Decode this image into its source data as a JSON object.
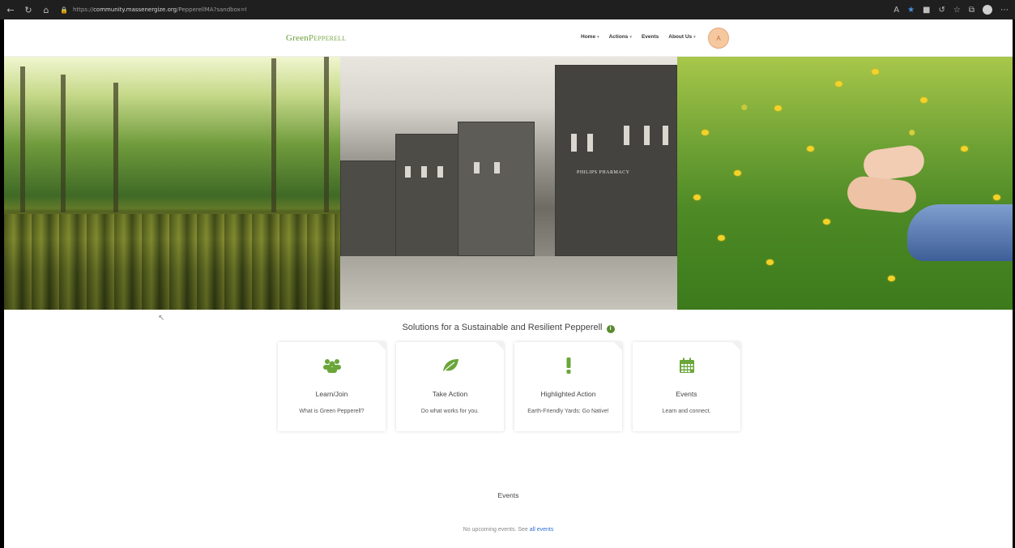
{
  "browser": {
    "url_prefix": "https://",
    "url_host": "community.massenergize.org",
    "url_path": "/PepperellMA?sandbox=true"
  },
  "header": {
    "logo_first": "Green",
    "logo_second": "Pepperell",
    "nav": [
      {
        "label": "Home",
        "has_caret": true
      },
      {
        "label": "Actions",
        "has_caret": true
      },
      {
        "label": "Events",
        "has_caret": false
      },
      {
        "label": "About Us",
        "has_caret": true
      }
    ],
    "avatar_initial": "A"
  },
  "hero": {
    "sign_text": "PHILIPS PHARMACY"
  },
  "solutions": {
    "title": "Solutions for a Sustainable and Resilient Pepperell",
    "info_icon": "i",
    "cards": [
      {
        "icon": "users-icon",
        "title": "Learn/Join",
        "description": "What is Green Pepperell?"
      },
      {
        "icon": "leaf-icon",
        "title": "Take Action",
        "description": "Do what works for you."
      },
      {
        "icon": "exclamation-icon",
        "title": "Highlighted Action",
        "description": "Earth-Friendly Yards: Go Native!"
      },
      {
        "icon": "calendar-icon",
        "title": "Events",
        "description": "Learn and connect."
      }
    ]
  },
  "events": {
    "title": "Events",
    "note_prefix": "No upcoming events. See",
    "note_link": "all events"
  },
  "colors": {
    "accent_green": "#6aa63a",
    "link_blue": "#2f6fd6"
  }
}
